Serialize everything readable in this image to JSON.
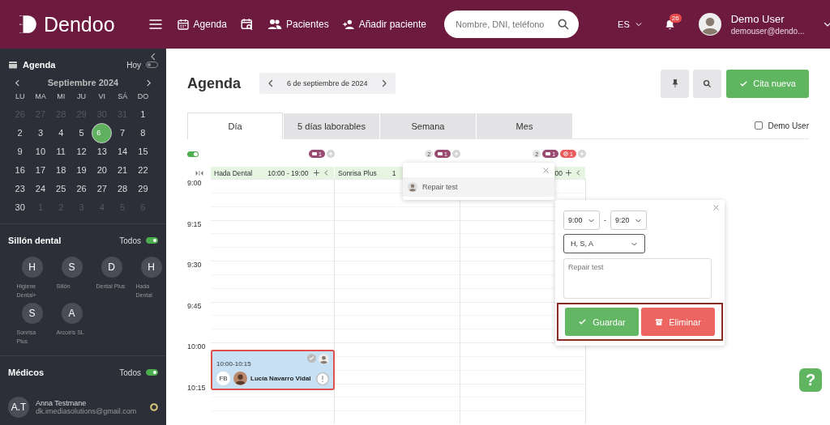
{
  "topbar": {
    "brand": "Dendoo",
    "nav": [
      {
        "kind": "agenda",
        "label": "Agenda"
      },
      {
        "kind": "calendar-search"
      },
      {
        "kind": "patients",
        "label": "Pacientes"
      },
      {
        "kind": "add-patient",
        "label": "Añadir paciente"
      }
    ],
    "search": {
      "placeholder": "Nombre, DNI, teléfono"
    },
    "language": "ES",
    "notifications": "26",
    "user": {
      "name": "Demo User",
      "email": "demouser@dendo..."
    }
  },
  "sidebar": {
    "agenda": {
      "title": "Agenda",
      "today_label": "Hoy",
      "today_on": false,
      "month": "Septiembre 2024",
      "weekdays": [
        "LU",
        "MA",
        "MI",
        "JU",
        "VI",
        "SÁ",
        "DO"
      ],
      "days": [
        {
          "label": "26",
          "muted": true,
          "selected": false
        },
        {
          "label": "27",
          "muted": true,
          "selected": false
        },
        {
          "label": "28",
          "muted": true,
          "selected": false
        },
        {
          "label": "29",
          "muted": true,
          "selected": false
        },
        {
          "label": "30",
          "muted": true,
          "selected": false
        },
        {
          "label": "31",
          "muted": true,
          "selected": false
        },
        {
          "label": "1",
          "muted": false,
          "selected": false
        },
        {
          "label": "2",
          "muted": false,
          "selected": false
        },
        {
          "label": "3",
          "muted": false,
          "selected": false
        },
        {
          "label": "4",
          "muted": false,
          "selected": false
        },
        {
          "label": "5",
          "muted": false,
          "selected": false
        },
        {
          "label": "6",
          "muted": false,
          "selected": true
        },
        {
          "label": "7",
          "muted": false,
          "selected": false
        },
        {
          "label": "8",
          "muted": false,
          "selected": false
        },
        {
          "label": "9",
          "muted": false,
          "selected": false
        },
        {
          "label": "10",
          "muted": false,
          "selected": false
        },
        {
          "label": "11",
          "muted": false,
          "selected": false
        },
        {
          "label": "12",
          "muted": false,
          "selected": false
        },
        {
          "label": "13",
          "muted": false,
          "selected": false
        },
        {
          "label": "14",
          "muted": false,
          "selected": false
        },
        {
          "label": "15",
          "muted": false,
          "selected": false
        },
        {
          "label": "16",
          "muted": false,
          "selected": false
        },
        {
          "label": "17",
          "muted": false,
          "selected": false
        },
        {
          "label": "18",
          "muted": false,
          "selected": false
        },
        {
          "label": "19",
          "muted": false,
          "selected": false
        },
        {
          "label": "20",
          "muted": false,
          "selected": false
        },
        {
          "label": "21",
          "muted": false,
          "selected": false
        },
        {
          "label": "22",
          "muted": false,
          "selected": false
        },
        {
          "label": "23",
          "muted": false,
          "selected": false
        },
        {
          "label": "24",
          "muted": false,
          "selected": false
        },
        {
          "label": "25",
          "muted": false,
          "selected": false
        },
        {
          "label": "26",
          "muted": false,
          "selected": false
        },
        {
          "label": "27",
          "muted": false,
          "selected": false
        },
        {
          "label": "28",
          "muted": false,
          "selected": false
        },
        {
          "label": "29",
          "muted": false,
          "selected": false
        },
        {
          "label": "30",
          "muted": false,
          "selected": false
        },
        {
          "label": "1",
          "muted": true,
          "selected": false
        },
        {
          "label": "2",
          "muted": true,
          "selected": false
        },
        {
          "label": "3",
          "muted": true,
          "selected": false
        },
        {
          "label": "4",
          "muted": true,
          "selected": false
        },
        {
          "label": "5",
          "muted": true,
          "selected": false
        },
        {
          "label": "6",
          "muted": true,
          "selected": false
        }
      ]
    },
    "chairs": {
      "title": "Sillón dental",
      "all_label": "Todos",
      "all_on": true,
      "items": [
        {
          "initial": "H",
          "name": "Higiene Dental+"
        },
        {
          "initial": "S",
          "name": "Sillón"
        },
        {
          "initial": "D",
          "name": "Dental Plus"
        },
        {
          "initial": "H",
          "name": "Hada Dental"
        },
        {
          "initial": "S",
          "name": "Sonrisa Plus"
        },
        {
          "initial": "A",
          "name": "Arcoíris SL"
        }
      ]
    },
    "doctors": {
      "title": "Médicos",
      "all_label": "Todos",
      "all_on": true,
      "items": [
        {
          "initials": "A.T",
          "name": "Anna Testmane",
          "email": "dk.imediasolutions@gmail.com"
        }
      ]
    }
  },
  "main": {
    "title": "Agenda",
    "date": "6 de septiembre de 2024",
    "new_button": "Cita nueva",
    "tabs": [
      {
        "label": "Día",
        "selected": true
      },
      {
        "label": "5 días laborables",
        "selected": false
      },
      {
        "label": "Semana",
        "selected": false
      },
      {
        "label": "Mes",
        "selected": false
      }
    ],
    "filter": {
      "label": "Demo User",
      "checked": false
    },
    "calendar": {
      "show_all_on": true,
      "columns": [
        {
          "name": "Hada Dental",
          "hours": "10:00 - 19:00",
          "controls": true,
          "badges": [
            {
              "kind": "message",
              "text": "1"
            },
            {
              "kind": "add"
            }
          ]
        },
        {
          "name": "Sonrisa Plus",
          "hours": "1",
          "badges": [
            {
              "kind": "count",
              "text": "2"
            },
            {
              "kind": "message",
              "text": "1"
            },
            {
              "kind": "add"
            }
          ]
        },
        {
          "hours": ":00",
          "controls": true,
          "badges": [
            {
              "kind": "count",
              "text": "2"
            },
            {
              "kind": "message",
              "text": "1"
            },
            {
              "kind": "cancelled",
              "text": "1"
            },
            {
              "kind": "add"
            }
          ]
        }
      ],
      "times": [
        "9:00",
        "9:15",
        "9:30",
        "9:45",
        "10:00",
        "10:15"
      ],
      "appointment": {
        "time": "10:00-10:15",
        "initials": "FB",
        "patient": "Lucía Navarro Vidal",
        "selected": true
      }
    },
    "note_popup": {
      "text": "Repair test"
    },
    "edit_popup": {
      "start": "9:00",
      "separator": "-",
      "end": "9:20",
      "chairs": "H, S, A",
      "note": "Repair test",
      "save": "Guardar",
      "delete": "Eliminar"
    }
  },
  "help": "?"
}
